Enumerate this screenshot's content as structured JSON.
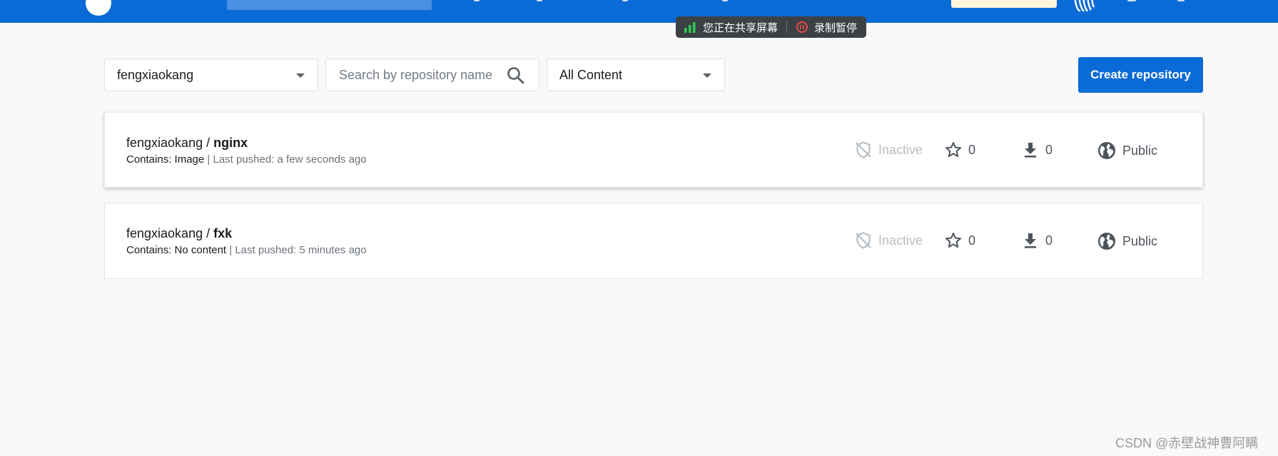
{
  "share_bar": {
    "sharing_label": "您正在共享屏幕",
    "recording_label": "录制暂停",
    "signal_color": "#2ecc52",
    "pause_color": "#e84b44"
  },
  "filters": {
    "namespace_value": "fengxiaokang",
    "search_placeholder": "Search by repository name",
    "content_value": "All Content"
  },
  "actions": {
    "create_repository_label": "Create repository"
  },
  "repositories": [
    {
      "namespace": "fengxiaokang",
      "separator": " / ",
      "name": "nginx",
      "contains_label": "Contains: ",
      "contains_value": "Image",
      "last_pushed": " | Last pushed: a few seconds ago",
      "status": "Inactive",
      "stars": "0",
      "pulls": "0",
      "visibility": "Public"
    },
    {
      "namespace": "fengxiaokang",
      "separator": " / ",
      "name": "fxk",
      "contains_label": "Contains: ",
      "contains_value": "No content",
      "last_pushed": " | Last pushed: 5 minutes ago",
      "status": "Inactive",
      "stars": "0",
      "pulls": "0",
      "visibility": "Public"
    }
  ],
  "watermark": "CSDN @赤壁战神曹阿瞒",
  "colors": {
    "brand_blue": "#0b6bd6",
    "inactive_gray": "#b9bec4",
    "stat_gray": "#4d545c"
  }
}
